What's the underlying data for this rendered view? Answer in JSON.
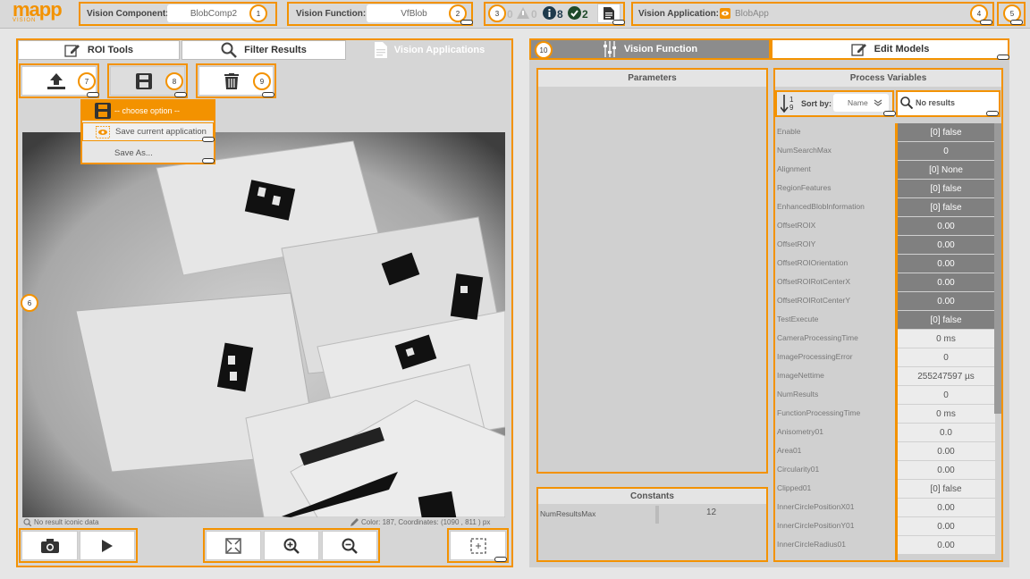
{
  "header": {
    "logo_text": "mapp",
    "logo_sub": "VISION",
    "vision_component_label": "Vision Component:",
    "vision_component_value": "BlobComp2",
    "vision_function_label": "Vision Function:",
    "vision_function_value": "VfBlob",
    "status_errors": "0",
    "status_warnings": "0",
    "status_info": "8",
    "status_ok": "2",
    "vision_application_label": "Vision Application:",
    "vision_application_value": "BlobApp"
  },
  "badges": {
    "b1": "1",
    "b2": "2",
    "b3": "3",
    "b4": "4",
    "b5": "5",
    "b6": "6",
    "b7": "7",
    "b8": "8",
    "b9": "9",
    "b10": "10"
  },
  "left_tabs": [
    "ROI Tools",
    "Filter Results",
    "Vision Applications"
  ],
  "save_menu": {
    "header": "-- choose option --",
    "item1": "Save current application",
    "item2": "Save As..."
  },
  "image_status": {
    "left": "No result iconic data",
    "right": "Color: 187, Coordinates: (1090 , 811 ) px"
  },
  "right_tabs": [
    "Vision Function",
    "Edit Models"
  ],
  "parameters": {
    "title": "Parameters"
  },
  "constants": {
    "title": "Constants",
    "rows": [
      {
        "name": "NumResultsMax",
        "value": "12"
      }
    ]
  },
  "process_variables": {
    "title": "Process Variables",
    "sort_label": "Sort by:",
    "sort_value": "Name",
    "search_value": "No results",
    "rows": [
      {
        "name": "Enable",
        "value": "[0] false",
        "style": "dk"
      },
      {
        "name": "NumSearchMax",
        "value": "0",
        "style": "dk"
      },
      {
        "name": "Alignment",
        "value": "[0] None",
        "style": "dk"
      },
      {
        "name": "RegionFeatures",
        "value": "[0] false",
        "style": "dk"
      },
      {
        "name": "EnhancedBlobInformation",
        "value": "[0] false",
        "style": "dk"
      },
      {
        "name": "OffsetROIX",
        "value": "0.00",
        "style": "dk"
      },
      {
        "name": "OffsetROIY",
        "value": "0.00",
        "style": "dk"
      },
      {
        "name": "OffsetROIOrientation",
        "value": "0.00",
        "style": "dk"
      },
      {
        "name": "OffsetROIRotCenterX",
        "value": "0.00",
        "style": "dk"
      },
      {
        "name": "OffsetROIRotCenterY",
        "value": "0.00",
        "style": "dk"
      },
      {
        "name": "TestExecute",
        "value": "[0] false",
        "style": "dk"
      },
      {
        "name": "CameraProcessingTime",
        "value": "0 ms",
        "style": "lt"
      },
      {
        "name": "ImageProcessingError",
        "value": "0",
        "style": "lt"
      },
      {
        "name": "ImageNettime",
        "value": "255247597 µs",
        "style": "lt"
      },
      {
        "name": "NumResults",
        "value": "0",
        "style": "lt"
      },
      {
        "name": "FunctionProcessingTime",
        "value": "0 ms",
        "style": "lt"
      },
      {
        "name": "Anisometry01",
        "value": "0.0",
        "style": "lt"
      },
      {
        "name": "Area01",
        "value": "0.00",
        "style": "lt"
      },
      {
        "name": "Circularity01",
        "value": "0.00",
        "style": "lt"
      },
      {
        "name": "Clipped01",
        "value": "[0] false",
        "style": "lt"
      },
      {
        "name": "InnerCirclePositionX01",
        "value": "0.00",
        "style": "lt"
      },
      {
        "name": "InnerCirclePositionY01",
        "value": "0.00",
        "style": "lt"
      },
      {
        "name": "InnerCircleRadius01",
        "value": "0.00",
        "style": "lt"
      }
    ]
  }
}
